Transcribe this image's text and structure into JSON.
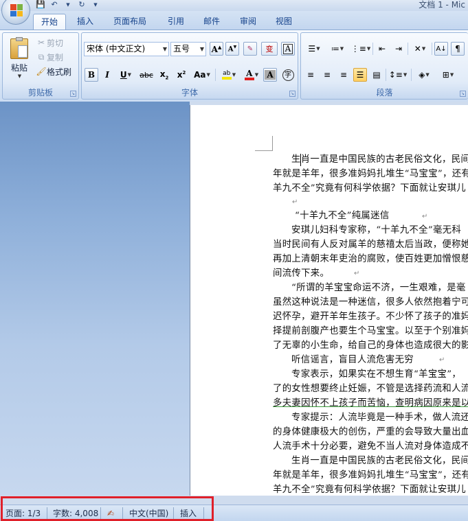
{
  "app": {
    "title": "文档 1 - Mic"
  },
  "tabs": [
    {
      "label": "开始"
    },
    {
      "label": "插入"
    },
    {
      "label": "页面布局"
    },
    {
      "label": "引用"
    },
    {
      "label": "邮件"
    },
    {
      "label": "审阅"
    },
    {
      "label": "视图"
    }
  ],
  "clipboard": {
    "label": "剪贴板",
    "paste": "粘贴",
    "cut": "剪切",
    "copy": "复制",
    "format_painter": "格式刷"
  },
  "font": {
    "label": "字体",
    "name": "宋体 (中文正文)",
    "size": "五号"
  },
  "paragraph": {
    "label": "段落"
  },
  "document": {
    "lines": [
      "生肖一直是中国民族的古老民俗文化，民间",
      "年就是羊年，很多准妈妈扎堆生“马宝宝”，还有",
      "羊九不全”究竟有何科学依据？下面就让安琪儿",
      "“十羊九不全”纯属迷信",
      "安琪儿妇科专家称，“十羊九不全”毫无科",
      "当时民间有人反对属羊的慈禧太后当政，便称她",
      "再加上清朝末年吏治的腐败，使百姓更加憎恨慈",
      "间流传下来。",
      "“所谓的羊宝宝命运不济，一生艰难，是毫",
      "虽然这种说法是一种迷信，很多人依然抱着宁可",
      "迟怀孕，避开羊年生孩子。不少怀了孩子的准妈",
      "择提前剖腹产也要生个马宝宝。以至于个别准妈",
      "了无辜的小生命，给自己的身体也造成很大的影",
      "听信谣言，盲目人流危害无穷",
      "专家表示，如果实在不想生育“羊宝宝”，",
      "了的女性想要终止妊娠，不管是选择药流和人流",
      "多夫妻因怀不上孩子而苦恼，查明病因原来是以",
      "专家提示：人流毕竟是一种手术，做人流还",
      "的身体健康极大的创伤，严重的会导致大量出血",
      "人流手术十分必要，避免不当人流对身体造成不",
      "生肖一直是中国民族的古老民俗文化，民间",
      "年就是羊年，很多准妈妈扎堆生“马宝宝”，还有",
      "羊九不全”究竟有何科学依据？下面就让安琪儿"
    ]
  },
  "status": {
    "page": "页面: 1/3",
    "words": "字数: 4,008",
    "language": "中文(中国)",
    "mode": "插入"
  },
  "colors": {
    "highlight_box": "#e0202a",
    "ribbon_text": "#15428b",
    "font_color_bar": "#e02020",
    "highlighter_bar": "#f5e60a"
  }
}
